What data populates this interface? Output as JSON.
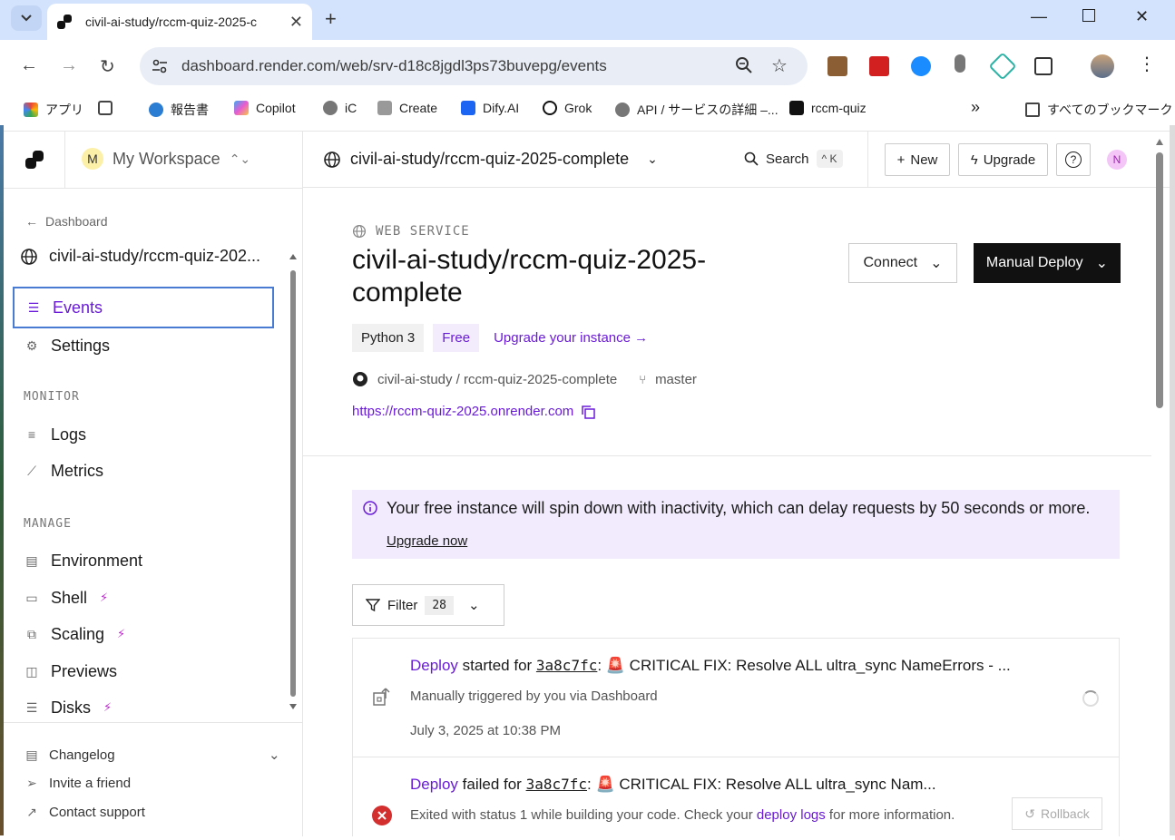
{
  "browser": {
    "tab_title": "civil-ai-study/rccm-quiz-2025-c",
    "url": "dashboard.render.com/web/srv-d18c8jgdl3ps73buvepg/events",
    "bookmarks": [
      "アプリ",
      "報告書",
      "Copilot",
      "iC",
      "Create",
      "Dify.AI",
      "Grok",
      "API / サービスの詳細 –...",
      "rccm-quiz"
    ],
    "all_bookmarks": "すべてのブックマーク"
  },
  "workspace": {
    "avatar": "M",
    "name": "My Workspace"
  },
  "sidebar": {
    "back_label": "Dashboard",
    "service_name": "civil-ai-study/rccm-quiz-202...",
    "items_top": [
      {
        "label": "Events",
        "icon": "list-icon"
      },
      {
        "label": "Settings",
        "icon": "gear-icon"
      }
    ],
    "monitor_header": "MONITOR",
    "monitor_items": [
      {
        "label": "Logs",
        "icon": "logs-icon"
      },
      {
        "label": "Metrics",
        "icon": "chart-icon"
      }
    ],
    "manage_header": "MANAGE",
    "manage_items": [
      {
        "label": "Environment",
        "icon": "environment-icon"
      },
      {
        "label": "Shell",
        "icon": "terminal-icon"
      },
      {
        "label": "Scaling",
        "icon": "scaling-icon"
      },
      {
        "label": "Previews",
        "icon": "preview-icon"
      },
      {
        "label": "Disks",
        "icon": "disk-icon"
      }
    ],
    "bottom_items": [
      {
        "label": "Changelog",
        "icon": "changelog-icon"
      },
      {
        "label": "Invite a friend",
        "icon": "send-icon"
      },
      {
        "label": "Contact support",
        "icon": "external-link-icon"
      }
    ]
  },
  "topbar": {
    "service_crumb": "civil-ai-study/rccm-quiz-2025-complete",
    "search_label": "Search",
    "search_shortcut": "^ K",
    "new_label": "New",
    "upgrade_label": "Upgrade",
    "user_avatar": "N"
  },
  "service": {
    "type": "WEB SERVICE",
    "title": "civil-ai-study/rccm-quiz-2025-complete",
    "connect_label": "Connect",
    "deploy_label": "Manual Deploy",
    "runtime_tag": "Python 3",
    "plan_tag": "Free",
    "upgrade_link": "Upgrade your instance",
    "repo": "civil-ai-study / rccm-quiz-2025-complete",
    "branch": "master",
    "url": "https://rccm-quiz-2025.onrender.com"
  },
  "notice": {
    "text": "Your free instance will spin down with inactivity, which can delay requests by 50 seconds or more.",
    "link": "Upgrade now"
  },
  "filter": {
    "label": "Filter",
    "count": "28"
  },
  "events": [
    {
      "keyword": "Deploy",
      "action": " started for ",
      "sha": "3a8c7fc",
      "message": ": 🚨 CRITICAL FIX: Resolve ALL ultra_sync NameErrors - ...",
      "detail": "Manually triggered by you via Dashboard",
      "time": "July 3, 2025 at 10:38 PM"
    },
    {
      "keyword": "Deploy",
      "action": " failed for ",
      "sha": "3a8c7fc",
      "message": ": 🚨 CRITICAL FIX: Resolve ALL ultra_sync Nam...",
      "detail_prefix": "Exited with status 1 while building your code. Check your ",
      "detail_link": "deploy logs",
      "detail_suffix": " for more information.",
      "rollback_label": "Rollback"
    }
  ],
  "colors": {
    "accent": "#6a1bd8",
    "notice_bg": "#f1ebfd",
    "error": "#d32f2f",
    "deploy_btn": "#111111"
  }
}
